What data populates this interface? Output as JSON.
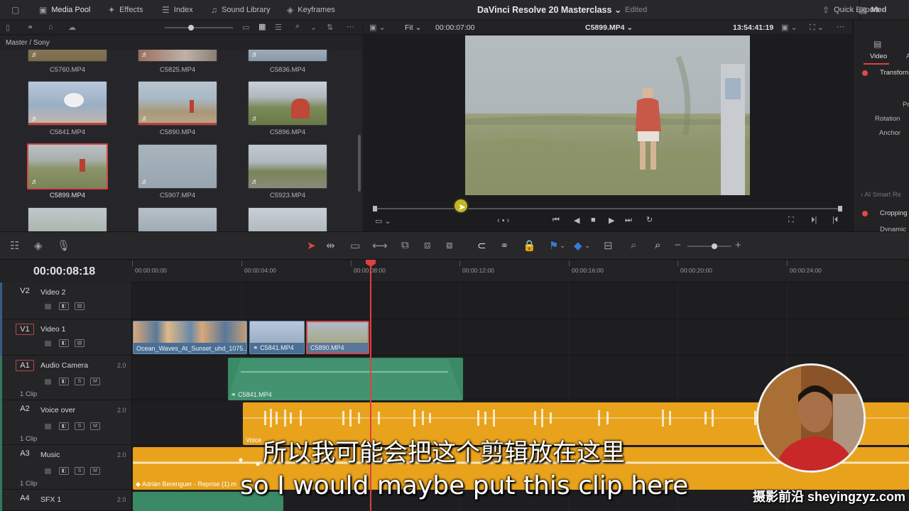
{
  "topbar": {
    "media_pool": "Media Pool",
    "effects": "Effects",
    "index": "Index",
    "sound_library": "Sound Library",
    "keyframes": "Keyframes",
    "project_title": "DaVinci Resolve 20 Masterclass",
    "project_status": "Edited",
    "quick_export": "Quick Export",
    "media_tab": "Med"
  },
  "media_pool": {
    "breadcrumb": "Master / Sony",
    "clips": [
      "C5760.MP4",
      "C5825.MP4",
      "C5836.MP4",
      "C5841.MP4",
      "C5890.MP4",
      "C5896.MP4",
      "C5899.MP4",
      "C5907.MP4",
      "C5923.MP4"
    ],
    "selected_clip": "C5899.MP4"
  },
  "viewer": {
    "fit": "Fit",
    "source_timecode": "00:00:07:00",
    "clip_name": "C5899.MP4",
    "record_timecode": "13:54:41:19"
  },
  "inspector": {
    "tab_video": "Video",
    "tab_audio": "A",
    "transform": "Transforn",
    "position": "Po",
    "rotation": "Rotation",
    "anchor": "Anchor",
    "ai_smart": "AI Smart Re",
    "cropping": "Cropping",
    "dynamic": "Dynamic"
  },
  "timeline": {
    "timecode": "00:00:08:18",
    "ruler": [
      "00:00:00:00",
      "00:00:04:00",
      "00:00:08:00",
      "00:00:12:00",
      "00:00:16:00",
      "00:00:20:00",
      "00:00:24:00"
    ],
    "tracks": [
      {
        "id": "V2",
        "name": "Video 2"
      },
      {
        "id": "V1",
        "name": "Video 1"
      },
      {
        "id": "A1",
        "name": "Audio Camera",
        "channels": "2.0",
        "clips": "1 Clip"
      },
      {
        "id": "A2",
        "name": "Voice over",
        "channels": "2.0",
        "clips": "1 Clip"
      },
      {
        "id": "A3",
        "name": "Music",
        "channels": "2.0",
        "clips": "1 Clip"
      },
      {
        "id": "A4",
        "name": "SFX 1",
        "channels": "2.0"
      }
    ],
    "clips": {
      "v1_a": "Ocean_Waves_At_Sunset_uhd_1075...",
      "v1_b": "C5841.MP4",
      "v1_c": "C5890.MP4",
      "a1": "C5841.MP4",
      "a2": "Voice",
      "a3": "Adrián Berenguer - Reprise (1).m"
    },
    "solo": "S",
    "mute": "M"
  },
  "subtitles": {
    "chinese": "所以我可能会把这个剪辑放在这里",
    "english": "so I would maybe put this clip here"
  },
  "watermark": "摄影前沿 sheyingzyz.com",
  "colors": {
    "accent_red": "#e04040",
    "video_clip_blue": "#4a6f96",
    "audio_green": "#3a8a66",
    "audio_orange": "#e8a21c"
  }
}
